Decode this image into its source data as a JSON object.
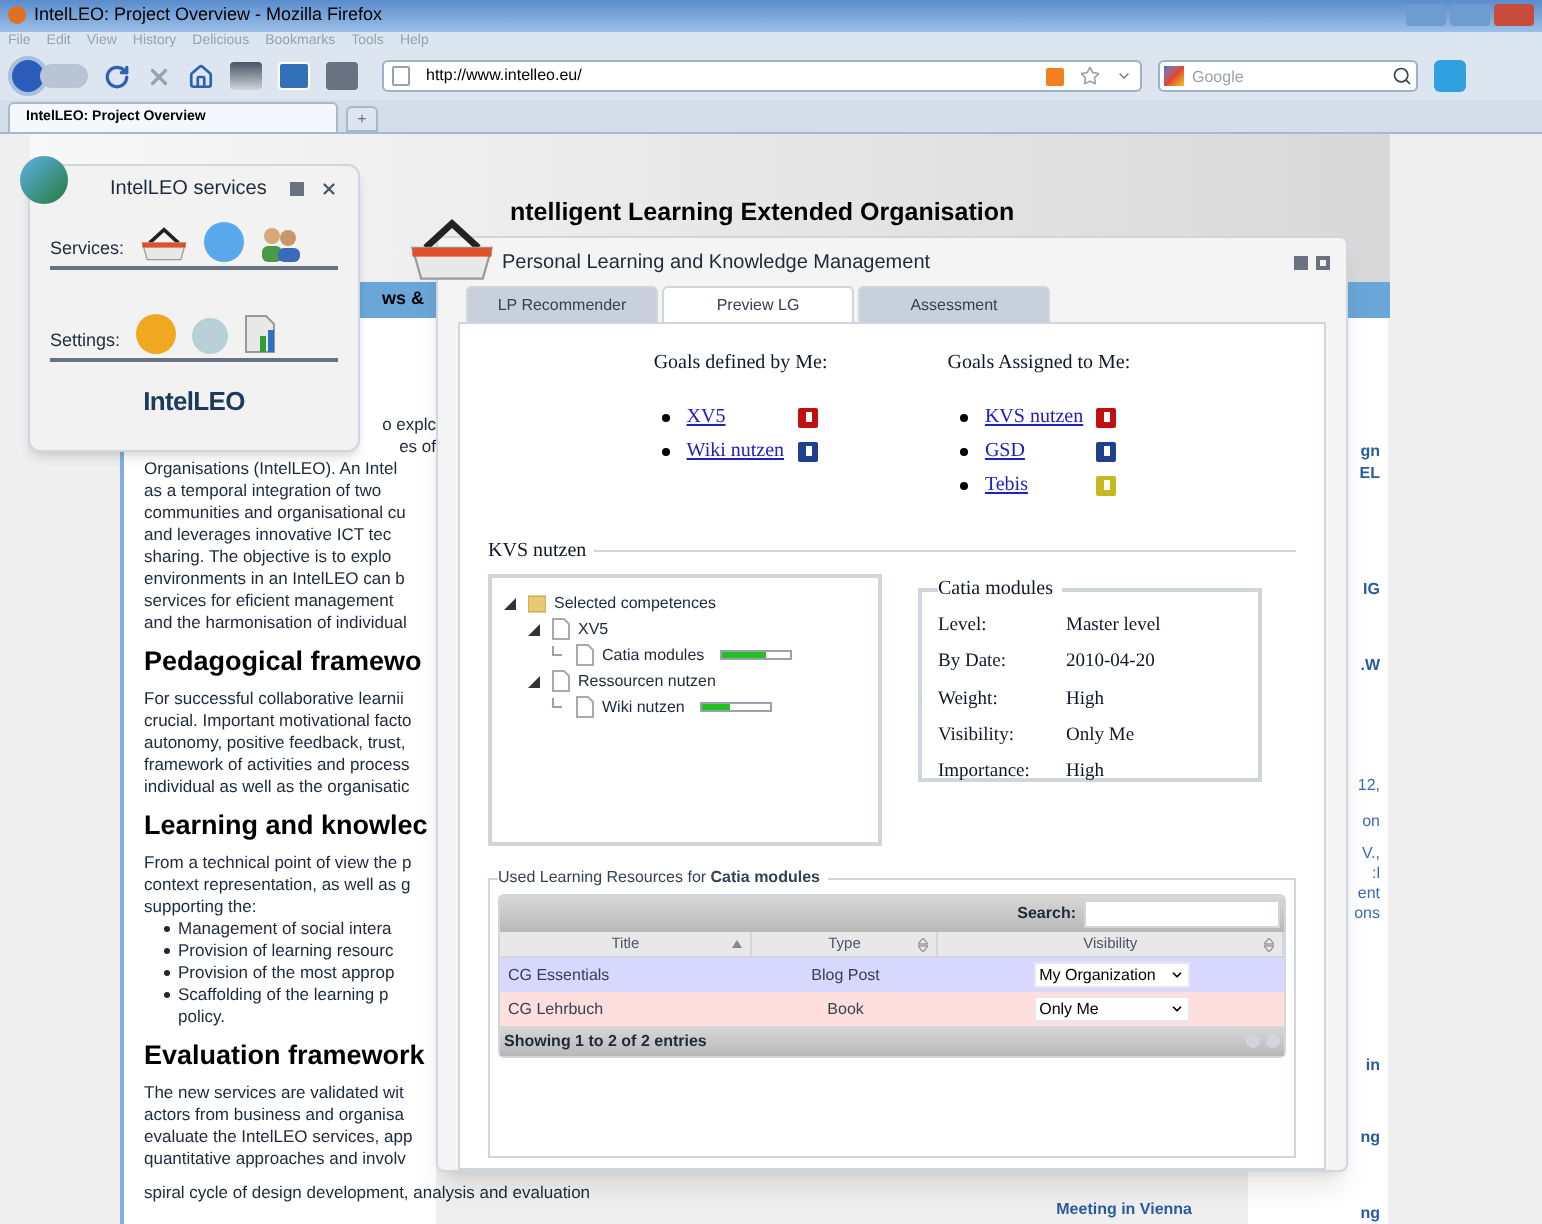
{
  "browser": {
    "title": "IntelLEO: Project Overview - Mozilla Firefox",
    "menu": [
      "File",
      "Edit",
      "View",
      "History",
      "Delicious",
      "Bookmarks",
      "Tools",
      "Help"
    ],
    "url": "http://www.intelleo.eu/",
    "search": {
      "placeholder": "Google"
    },
    "tabs": [
      {
        "label": "IntelLEO: Project Overview",
        "selected": true
      }
    ],
    "new_tab": "+"
  },
  "page": {
    "header": "ntelligent Learning Extended Organisation",
    "nav": "ws &",
    "left_column": [
      {
        "kind": "fragment",
        "text": "o explc"
      },
      {
        "kind": "fragment",
        "text": "es of"
      },
      {
        "kind": "line",
        "text": "Organisations (IntelLEO). An Intel"
      },
      {
        "kind": "line",
        "text": "as a temporal integration of two"
      },
      {
        "kind": "line",
        "text": "communities and organisational cu"
      },
      {
        "kind": "line",
        "text": "and leverages innovative ICT tec"
      },
      {
        "kind": "line",
        "text": "sharing. The objective is to explo"
      },
      {
        "kind": "line",
        "text": "environments in an IntelLEO can b"
      },
      {
        "kind": "line",
        "text": "services for eficient management"
      },
      {
        "kind": "line",
        "text": "and the harmonisation of individual"
      },
      {
        "kind": "heading",
        "text": "Pedagogical framewo"
      },
      {
        "kind": "line",
        "text": "For successful collaborative learnii"
      },
      {
        "kind": "line",
        "text": "crucial. Important motivational facto"
      },
      {
        "kind": "line",
        "text": "autonomy, positive feedback, trust,"
      },
      {
        "kind": "line",
        "text": "framework of activities and process"
      },
      {
        "kind": "line",
        "text": "individual as well as the organisatic"
      },
      {
        "kind": "heading",
        "text": "Learning and knowlec"
      },
      {
        "kind": "line",
        "text": "From a technical point of view the p"
      },
      {
        "kind": "line",
        "text": "context representation, as well as g"
      },
      {
        "kind": "line",
        "text": "supporting the:"
      },
      {
        "kind": "bullet",
        "text": "Management of social intera"
      },
      {
        "kind": "bullet",
        "text": "Provision of learning resourc"
      },
      {
        "kind": "bullet",
        "text": "Provision of the most approp"
      },
      {
        "kind": "bullet",
        "text": "Scaffolding of the learning p"
      },
      {
        "kind": "continuation",
        "text": "policy."
      },
      {
        "kind": "heading",
        "text": "Evaluation framework"
      },
      {
        "kind": "line",
        "text": "The new services are validated wit"
      },
      {
        "kind": "line",
        "text": "actors from business and organisa"
      },
      {
        "kind": "line",
        "text": "evaluate the IntelLEO services, app"
      },
      {
        "kind": "line",
        "text": "quantitative approaches and involv"
      },
      {
        "kind": "line",
        "text": "spiral cycle of design development, analysis and evaluation"
      }
    ],
    "right_column": [
      {
        "kind": "link",
        "text": "gn"
      },
      {
        "kind": "link",
        "text": "EL"
      },
      {
        "kind": "link",
        "text": "IG"
      },
      {
        "kind": "link",
        "text": ".W"
      },
      {
        "kind": "plain",
        "text": "12,"
      },
      {
        "kind": "plain",
        "text": "on"
      },
      {
        "kind": "plain",
        "text": "V.,"
      },
      {
        "kind": "plain",
        "text": ":l"
      },
      {
        "kind": "plain",
        "text": "ent"
      },
      {
        "kind": "plain",
        "text": "ons"
      },
      {
        "kind": "link",
        "text": "in"
      },
      {
        "kind": "link",
        "text": "ng"
      },
      {
        "kind": "link",
        "text": "ng"
      }
    ],
    "footer_link": "Meeting in Vienna"
  },
  "services_widget": {
    "title": "IntelLEO services",
    "services_label": "Services:",
    "settings_label": "Settings:",
    "logo": "IntelLEO"
  },
  "dialog": {
    "title": "Personal Learning and Knowledge Management",
    "tabs": [
      {
        "label": "LP Recommender",
        "selected": false
      },
      {
        "label": "Preview LG",
        "selected": true
      },
      {
        "label": "Assessment",
        "selected": false
      }
    ],
    "goals_defined": {
      "heading": "Goals defined by Me:",
      "items": [
        {
          "label": "XV5",
          "color": "#c01010"
        },
        {
          "label": "Wiki nutzen",
          "color": "#1f3f8f"
        }
      ]
    },
    "goals_assigned": {
      "heading": "Goals Assigned to Me:",
      "items": [
        {
          "label": "KVS nutzen",
          "color": "#c01010"
        },
        {
          "label": "GSD",
          "color": "#1f3f8f"
        },
        {
          "label": "Tebis",
          "color": "#c8b820"
        }
      ]
    },
    "goal_panel": {
      "legend": "KVS nutzen",
      "tree": [
        {
          "label": "Selected competences",
          "expanded": true,
          "children": [
            {
              "label": "XV5",
              "expanded": true,
              "children": [
                {
                  "label": "Catia modules",
                  "level": 0.65
                }
              ]
            },
            {
              "label": "Ressourcen nutzen",
              "expanded": true,
              "children": [
                {
                  "label": "Wiki nutzen",
                  "level": 0.4
                }
              ]
            }
          ]
        }
      ],
      "details": {
        "legend": "Catia modules",
        "rows": [
          {
            "label": "Level:",
            "value": "Master level"
          },
          {
            "label": "By Date:",
            "value": "2010-04-20"
          },
          {
            "label": "Weight:",
            "value": "High"
          },
          {
            "label": "Visibility:",
            "value": "Only Me"
          },
          {
            "label": "Importance:",
            "value": "High"
          }
        ]
      }
    },
    "resources": {
      "legend": "Used Learning Resources for **Catia modules**",
      "search_label": "Search:",
      "columns": [
        {
          "label": "Title",
          "sorted": true
        },
        {
          "label": "Type",
          "sorted": false
        },
        {
          "label": "Visibility",
          "sorted": false
        }
      ],
      "rows": [
        {
          "title": "CG Essentials",
          "type": "Blog Post",
          "visibility": "My Organization",
          "color": "#d8d8ff"
        },
        {
          "title": "CG Lehrbuch",
          "type": "Book",
          "visibility": "Only Me",
          "color": "#ffdede"
        }
      ],
      "footer": "Showing 1 to 2 of 2 entries"
    }
  }
}
